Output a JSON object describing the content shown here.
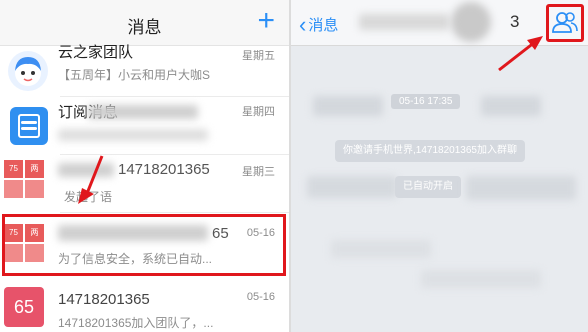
{
  "left": {
    "title": "消息",
    "add_icon": "plus-icon",
    "conversations": [
      {
        "name": "云之家团队",
        "preview": "【五周年】小云和用户大咖S",
        "time": "星期五",
        "avatar": "cloud-mascot"
      },
      {
        "name": "订阅消息",
        "preview": "",
        "time": "星期四",
        "avatar": "note-icon"
      },
      {
        "name": "14718201365",
        "preview": "发起了语",
        "time": "星期三",
        "avatar_tiles": [
          "75",
          "两",
          "",
          ""
        ]
      },
      {
        "name": "65",
        "preview": "为了信息安全，系统已自动...",
        "time": "05-16",
        "avatar_tiles": [
          "75",
          "两",
          "",
          ""
        ]
      },
      {
        "name": "14718201365",
        "preview": "14718201365加入团队了，...",
        "time": "05-16",
        "avatar": "65"
      }
    ]
  },
  "right": {
    "back_label": "消息",
    "title_digit": "3",
    "people_icon": "group-members-icon",
    "timestamp": "05-16 17:35",
    "system_messages": [
      "你邀请手机世界,14718201365加入群聊",
      "已自动开启"
    ]
  },
  "colors": {
    "accent": "#2b8ff6",
    "highlight": "#e0171c"
  }
}
